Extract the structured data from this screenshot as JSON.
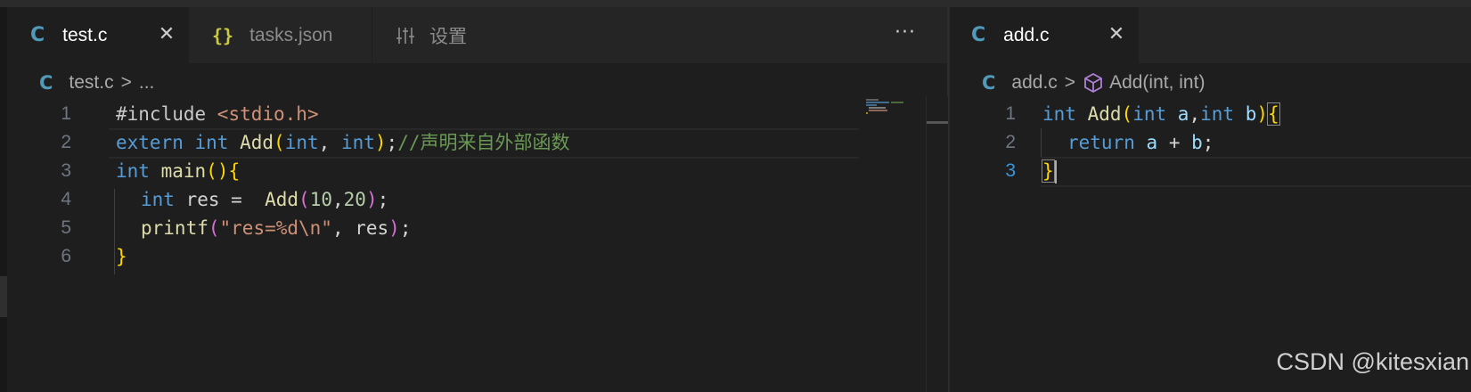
{
  "left_editor": {
    "tabs": [
      {
        "label": "test.c",
        "icon": "C",
        "active": true,
        "close": "✕"
      },
      {
        "label": "tasks.json",
        "icon": "{}",
        "active": false
      },
      {
        "label": "设置",
        "icon": "settings-sliders-icon",
        "active": false
      }
    ],
    "more_actions": "···",
    "breadcrumb": {
      "icon": "C",
      "file": "test.c",
      "sep": ">",
      "rest": "..."
    },
    "line_numbers": [
      "1",
      "2",
      "3",
      "4",
      "5",
      "6"
    ],
    "code": {
      "l1": {
        "directive": "#include ",
        "header": "<stdio.h>"
      },
      "l2": {
        "kw1": "extern",
        "kw2": "int",
        "fn": "Add",
        "open": "(",
        "t1": "int",
        "comma": ", ",
        "t2": "int",
        "close": ")",
        "semi": ";",
        "comment": "//声明来自外部函数"
      },
      "l3": {
        "kw": "int",
        "fn": "main",
        "parens": "()",
        "brace": "{"
      },
      "l4": {
        "kw": "int",
        "var": " res = ",
        "fn": "Add",
        "open": "(",
        "a": "10",
        "comma": ",",
        "b": "20",
        "close": ")",
        "semi": ";"
      },
      "l5": {
        "fn": "printf",
        "open": "(",
        "str": "\"res=%d\\n\"",
        "mid": ", res",
        "close": ")",
        "semi": ";"
      },
      "l6": {
        "brace": "}"
      }
    }
  },
  "right_editor": {
    "tabs": [
      {
        "label": "add.c",
        "icon": "C",
        "active": true,
        "close": "✕"
      }
    ],
    "breadcrumb": {
      "icon": "C",
      "file": "add.c",
      "sep": ">",
      "symbol": "Add(int, int)"
    },
    "line_numbers": [
      "1",
      "2",
      "3"
    ],
    "code": {
      "l1": {
        "kw": "int",
        "fn": "Add",
        "open": "(",
        "t1": "int",
        "p1": "a",
        "comma": ",",
        "t2": "int",
        "p2": "b",
        "close": ")",
        "brace": "{"
      },
      "l2": {
        "kw": "return",
        "a": "a",
        "op": " + ",
        "b": "b",
        "semi": ";"
      },
      "l3": {
        "brace": "}"
      }
    }
  },
  "watermark": "CSDN @kitesxian",
  "colors": {
    "keyword": "#569cd6",
    "function": "#dcdcaa",
    "comment": "#6a9955",
    "number": "#b5cea8",
    "string": "#ce9178",
    "c_icon": "#519aba",
    "json_icon": "#cbcb41",
    "bracket_gold": "#ffd700",
    "bracket_purple": "#da70d6"
  }
}
